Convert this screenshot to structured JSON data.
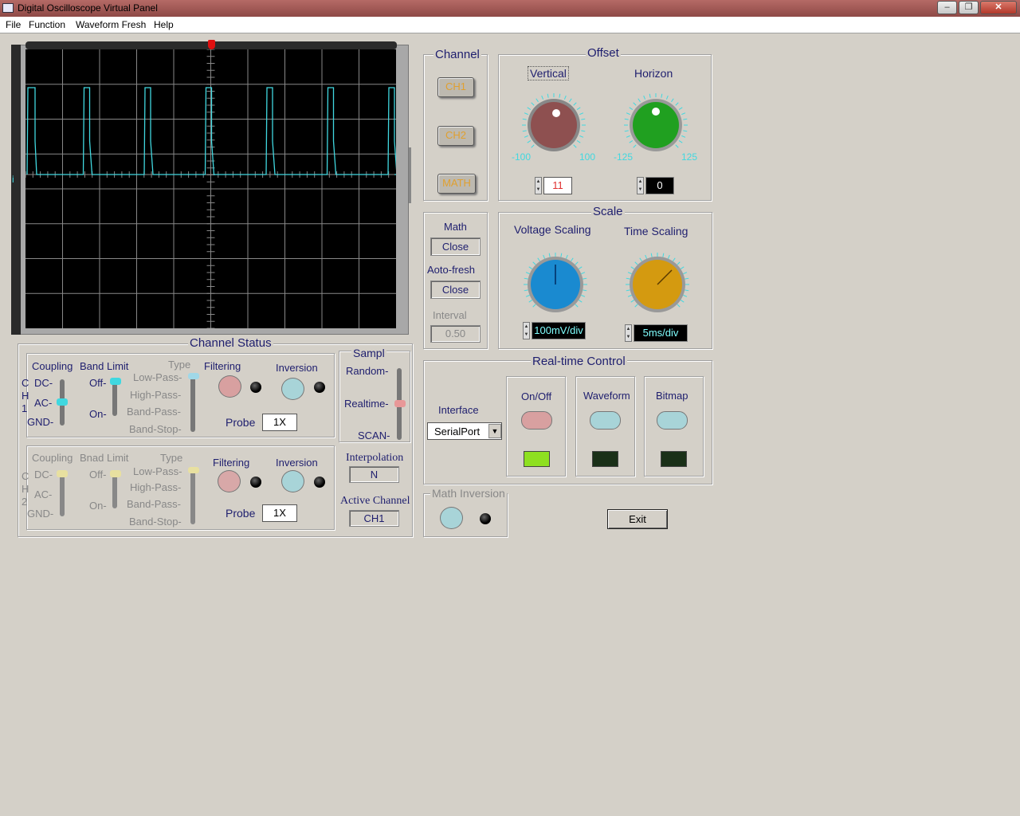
{
  "window": {
    "title": "Digital Oscilloscope Virtual Panel"
  },
  "menu": [
    "File",
    "Function",
    "Waveform Fresh",
    "Help"
  ],
  "scope": {
    "ch_marker": "i"
  },
  "channel": {
    "title": "Channel",
    "ch1": "CH1",
    "ch2": "CH2",
    "math": "MATH"
  },
  "offset": {
    "title": "Offset",
    "vertical": {
      "label": "Vertical",
      "min": "-100",
      "max": "100",
      "value": "11"
    },
    "horizon": {
      "label": "Horizon",
      "min": "-125",
      "max": "125",
      "value": "0"
    }
  },
  "math_panel": {
    "math_label": "Math",
    "math_value": "Close",
    "autofresh_label": "Aoto-fresh",
    "autofresh_value": "Close",
    "interval_label": "Interval",
    "interval_value": "0.50"
  },
  "scale": {
    "title": "Scale",
    "voltage_label": "Voltage Scaling",
    "voltage_value": "100mV/div",
    "time_label": "Time Scaling",
    "time_value": "5ms/div"
  },
  "channel_status": {
    "title": "Channel Status",
    "ch1": {
      "side": [
        "C",
        "H",
        "1"
      ],
      "coupling": "Coupling",
      "coupling_opts": [
        "DC-",
        "AC-",
        "GND-"
      ],
      "coupling_selected": "AC",
      "band": "Band Limit",
      "band_opts": [
        "Off-",
        "On-"
      ],
      "band_selected": "Off",
      "type": "Type",
      "type_opts": [
        "Low-Pass-",
        "High-Pass-",
        "Band-Pass-",
        "Band-Stop-"
      ],
      "type_selected": "Low-Pass",
      "filtering": "Filtering",
      "inversion": "Inversion",
      "probe_label": "Probe",
      "probe_value": "1X"
    },
    "ch2": {
      "side": [
        "C",
        "H",
        "2"
      ],
      "coupling": "Coupling",
      "coupling_opts": [
        "DC-",
        "AC-",
        "GND-"
      ],
      "coupling_selected": "DC",
      "band": "Bnad Limit",
      "band_opts": [
        "Off-",
        "On-"
      ],
      "band_selected": "Off",
      "type": "Type",
      "type_opts": [
        "Low-Pass-",
        "High-Pass-",
        "Band-Pass-",
        "Band-Stop-"
      ],
      "type_selected": "Low-Pass",
      "filtering": "Filtering",
      "inversion": "Inversion",
      "probe_label": "Probe",
      "probe_value": "1X"
    },
    "sampl": {
      "title": "Sampl",
      "opts": [
        "Random-",
        "Realtime-",
        "SCAN-"
      ],
      "selected": "Realtime"
    },
    "interpolation": {
      "label": "Interpolation",
      "value": "N"
    },
    "active_channel": {
      "label": "Active Channel",
      "value": "CH1"
    }
  },
  "realtime": {
    "title": "Real-time Control",
    "interface_label": "Interface",
    "interface_value": "SerialPort",
    "onoff": "On/Off",
    "waveform": "Waveform",
    "bitmap": "Bitmap"
  },
  "math_inversion": {
    "title": "Math Inversion"
  },
  "exit_label": "Exit",
  "colors": {
    "trace": "#40d8e0",
    "led_on": "#8ee020",
    "led_off": "#1a3018",
    "knob_vertical": "#8e5050",
    "knob_horizon": "#20a020",
    "knob_voltage": "#1a8ad0",
    "knob_time": "#d49a10"
  }
}
